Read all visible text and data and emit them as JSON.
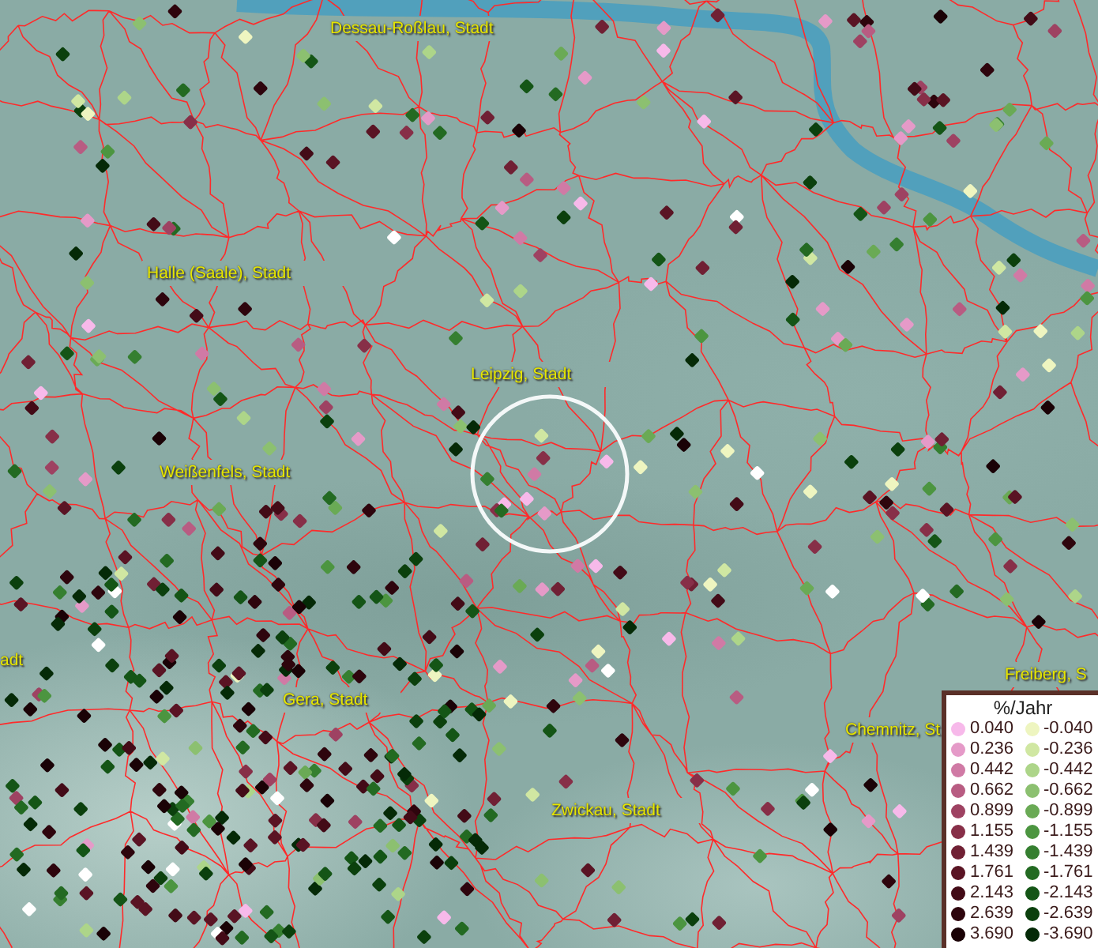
{
  "map": {
    "places": [
      {
        "name": "Dessau-Roßlau, Stadt"
      },
      {
        "name": "Halle (Saale), Stadt"
      },
      {
        "name": "Leipzig, Stadt"
      },
      {
        "name": "Weißenfels, Stadt"
      },
      {
        "name": "adt"
      },
      {
        "name": "Gera, Stadt"
      },
      {
        "name": "Freiberg, S"
      },
      {
        "name": "Chemnitz, St"
      },
      {
        "name": "Zwickau, Stadt"
      }
    ]
  },
  "legend": {
    "title": "%/Jahr",
    "rows": [
      {
        "increase": {
          "value": "0.040",
          "color": "#f7b9ea"
        },
        "decrease": {
          "value": "-0.040",
          "color": "#eef5c0"
        }
      },
      {
        "increase": {
          "value": "0.236",
          "color": "#e59ac8"
        },
        "decrease": {
          "value": "-0.236",
          "color": "#d0e7a2"
        }
      },
      {
        "increase": {
          "value": "0.442",
          "color": "#d07aa5"
        },
        "decrease": {
          "value": "-0.442",
          "color": "#add589"
        }
      },
      {
        "increase": {
          "value": "0.662",
          "color": "#b85c82"
        },
        "decrease": {
          "value": "-0.662",
          "color": "#8cc070"
        }
      },
      {
        "increase": {
          "value": "0.899",
          "color": "#9e4262"
        },
        "decrease": {
          "value": "-0.899",
          "color": "#6aaa55"
        }
      },
      {
        "increase": {
          "value": "1.155",
          "color": "#872f48"
        },
        "decrease": {
          "value": "-1.155",
          "color": "#4c9540"
        }
      },
      {
        "increase": {
          "value": "1.439",
          "color": "#702034"
        },
        "decrease": {
          "value": "-1.439",
          "color": "#357f30"
        }
      },
      {
        "increase": {
          "value": "1.761",
          "color": "#5a1424"
        },
        "decrease": {
          "value": "-1.761",
          "color": "#236a22"
        }
      },
      {
        "increase": {
          "value": "2.143",
          "color": "#430b17"
        },
        "decrease": {
          "value": "-2.143",
          "color": "#145516"
        }
      },
      {
        "increase": {
          "value": "2.639",
          "color": "#2e050d"
        },
        "decrease": {
          "value": "-2.639",
          "color": "#0b400d"
        }
      },
      {
        "increase": {
          "value": "3.690",
          "color": "#1a0206"
        },
        "decrease": {
          "value": "-3.690",
          "color": "#052a07"
        }
      }
    ]
  }
}
